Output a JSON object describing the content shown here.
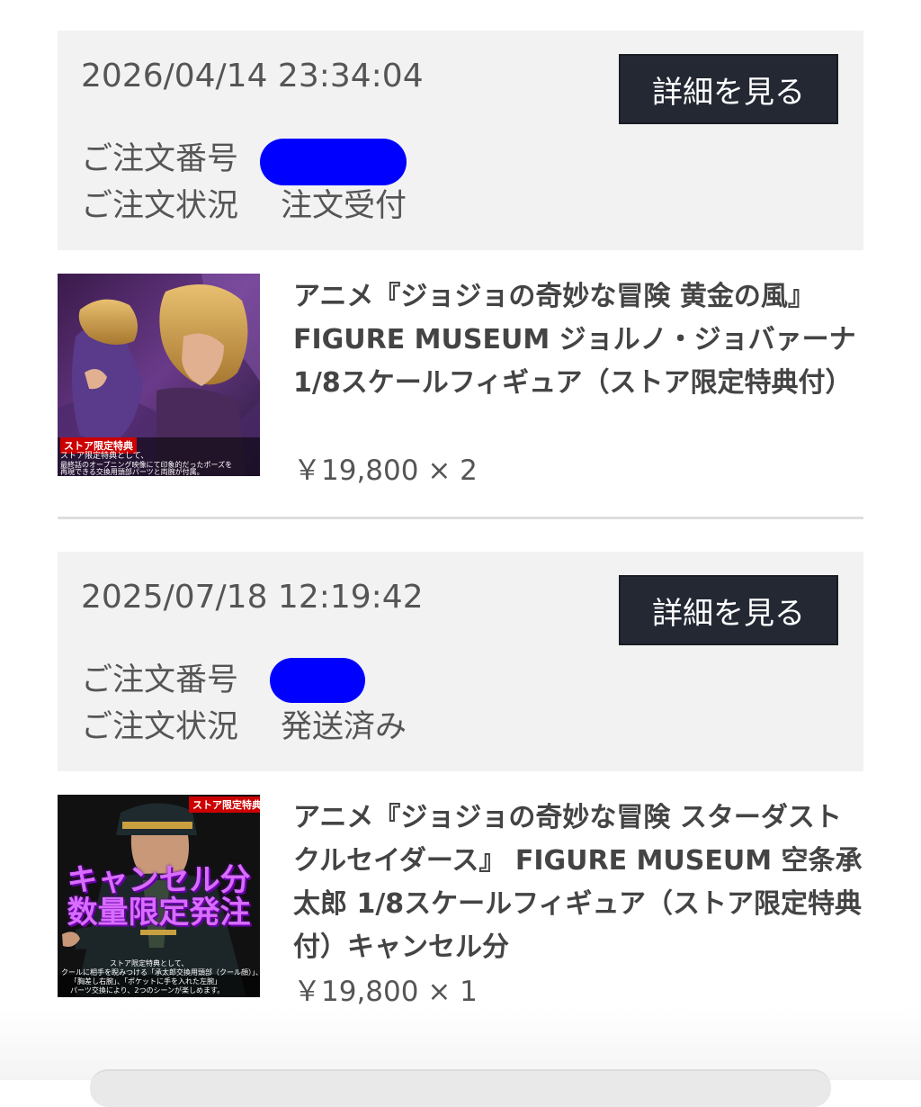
{
  "labels": {
    "order_number": "ご注文番号",
    "order_status": "ご注文状況",
    "detail_button": "詳細を見る"
  },
  "orders": [
    {
      "datetime": "2026/04/14 23:34:04",
      "status": "注文受付",
      "product": {
        "name": "アニメ『ジョジョの奇妙な冒険 黄金の風』FIGURE MUSEUM ジョルノ・ジョバァーナ 1/8スケールフィギュア（ストア限定特典付）",
        "price": "￥19,800 × 2",
        "thumbnail": {
          "badge": "ストア限定特典",
          "note_lines": [
            "ストア限定特典として、",
            "最終話のオープニング映像にて印象的だったポーズを",
            "再現できる交換用頭部パーツと両腕が付属。"
          ]
        }
      }
    },
    {
      "datetime": "2025/07/18 12:19:42",
      "status": "発送済み",
      "product": {
        "name": "アニメ『ジョジョの奇妙な冒険 スターダストクルセイダース』 FIGURE MUSEUM 空条承太郎 1/8スケールフィギュア（ストア限定特典付）キャンセル分",
        "price": "￥19,800 × 1",
        "thumbnail": {
          "badge": "ストア限定特典",
          "overlay_lines": [
            "キャンセル分",
            "数量限定発注"
          ],
          "note_lines": [
            "ストア限定特典として、",
            "クールに相手を睨みつける「承太郎交換用頭部（クール顔）」、",
            "「胸差し右腕」、「ポケットに手を入れた左腕」",
            "パーツ交換により、2つのシーンが楽しめます。"
          ]
        }
      }
    }
  ],
  "colors": {
    "header_bg": "#f2f2f2",
    "button_bg": "#232833",
    "redaction": "#0000ff"
  }
}
